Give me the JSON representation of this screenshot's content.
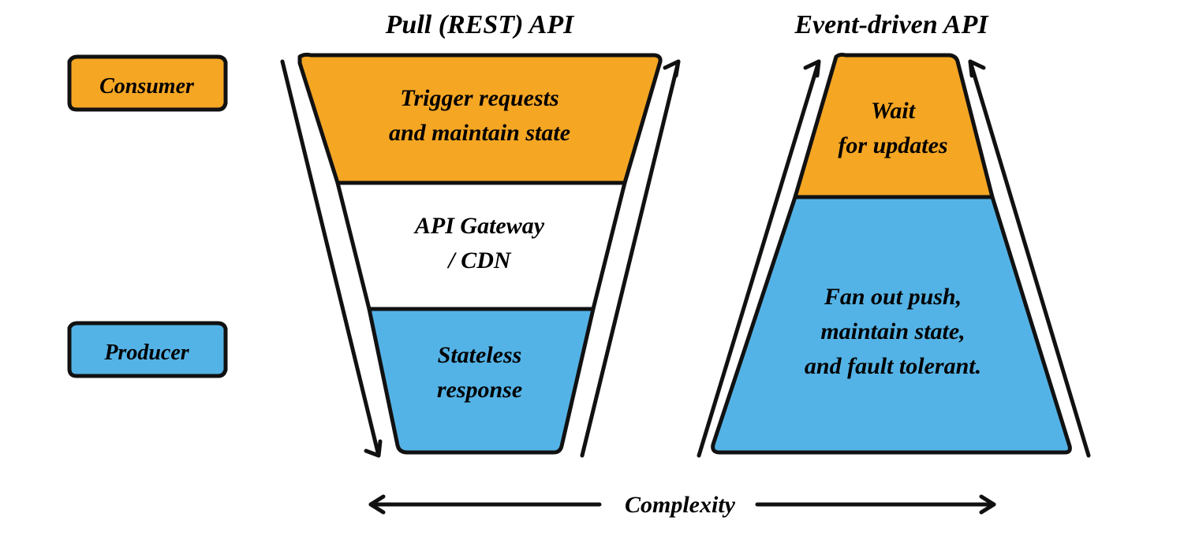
{
  "titles": {
    "left": "Pull (REST) API",
    "right": "Event-driven API"
  },
  "roles": {
    "consumer": "Consumer",
    "producer": "Producer"
  },
  "left_shape": {
    "top": {
      "line1": "Trigger requests",
      "line2": "and maintain state"
    },
    "middle": {
      "line1": "API Gateway",
      "line2": "/ CDN"
    },
    "bottom": {
      "line1": "Stateless",
      "line2": "response"
    }
  },
  "right_shape": {
    "top": {
      "line1": "Wait",
      "line2": "for updates"
    },
    "bottom": {
      "line1": "Fan out push,",
      "line2": "maintain state,",
      "line3": "and fault tolerant."
    }
  },
  "axis": {
    "label": "Complexity"
  },
  "colors": {
    "orange": "#F5A623",
    "blue": "#54B3E6",
    "stroke": "#111111"
  }
}
